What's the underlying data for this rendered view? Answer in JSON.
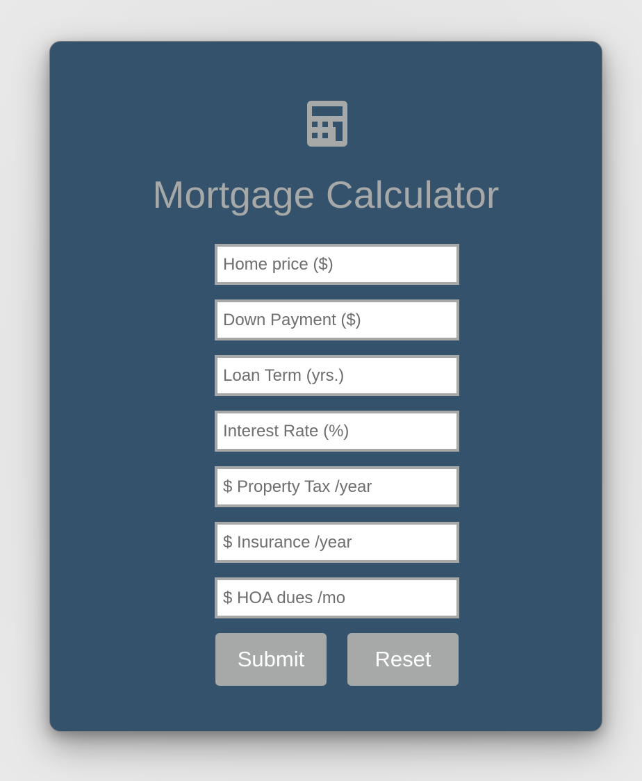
{
  "app": {
    "title": "Mortgage Calculator",
    "icon": "calculator-icon"
  },
  "form": {
    "fields": [
      {
        "name": "home-price-input",
        "placeholder": "Home price ($)",
        "value": ""
      },
      {
        "name": "down-payment-input",
        "placeholder": "Down Payment ($)",
        "value": ""
      },
      {
        "name": "loan-term-input",
        "placeholder": "Loan Term (yrs.)",
        "value": ""
      },
      {
        "name": "interest-rate-input",
        "placeholder": "Interest Rate (%)",
        "value": ""
      },
      {
        "name": "property-tax-input",
        "placeholder": "$ Property Tax /year",
        "value": ""
      },
      {
        "name": "insurance-input",
        "placeholder": "$ Insurance /year",
        "value": ""
      },
      {
        "name": "hoa-dues-input",
        "placeholder": "$ HOA dues /mo",
        "value": ""
      }
    ],
    "submit_label": "Submit",
    "reset_label": "Reset"
  },
  "colors": {
    "page_background": "#e2e2e2",
    "card_background": "#34526b",
    "muted_gray": "#a6a9a8",
    "input_background": "#ffffff",
    "button_text": "#ffffff"
  }
}
